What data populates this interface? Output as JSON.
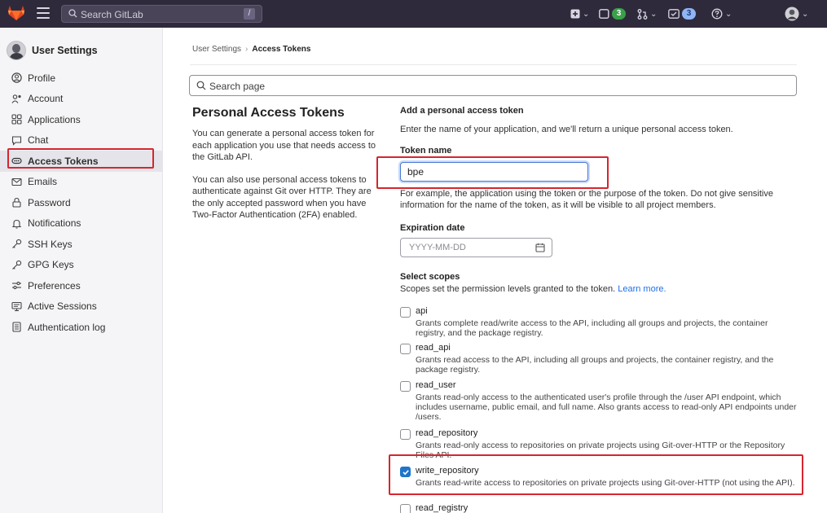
{
  "topbar": {
    "search_placeholder": "Search GitLab",
    "search_shortcut": "/",
    "mr_count": "3",
    "todo_count": "3",
    "colors": {
      "background": "#2f2a3b"
    }
  },
  "sidebar": {
    "context_title": "User Settings",
    "items": [
      {
        "label": "Profile",
        "icon": "profile-icon"
      },
      {
        "label": "Account",
        "icon": "account-icon"
      },
      {
        "label": "Applications",
        "icon": "applications-icon"
      },
      {
        "label": "Chat",
        "icon": "chat-icon"
      },
      {
        "label": "Access Tokens",
        "icon": "token-icon",
        "active": true
      },
      {
        "label": "Emails",
        "icon": "mail-icon"
      },
      {
        "label": "Password",
        "icon": "lock-icon"
      },
      {
        "label": "Notifications",
        "icon": "bell-icon"
      },
      {
        "label": "SSH Keys",
        "icon": "key-icon"
      },
      {
        "label": "GPG Keys",
        "icon": "key-icon"
      },
      {
        "label": "Preferences",
        "icon": "preferences-icon"
      },
      {
        "label": "Active Sessions",
        "icon": "monitor-icon"
      },
      {
        "label": "Authentication log",
        "icon": "log-icon"
      }
    ]
  },
  "breadcrumb": {
    "root": "User Settings",
    "separator": "›",
    "current": "Access Tokens"
  },
  "page_search": {
    "placeholder": "Search page"
  },
  "intro": {
    "title": "Personal Access Tokens",
    "paragraph_1": "You can generate a personal access token for each application you use that needs access to the GitLab API.",
    "paragraph_2": "You can also use personal access tokens to authenticate against Git over HTTP. They are the only accepted password when you have Two-Factor Authentication (2FA) enabled."
  },
  "form": {
    "heading": "Add a personal access token",
    "description": "Enter the name of your application, and we'll return a unique personal access token.",
    "token_name_label": "Token name",
    "token_name_value": "bpe",
    "token_name_help": "For example, the application using the token or the purpose of the token. Do not give sensitive information for the name of the token, as it will be visible to all project members.",
    "expiration_label": "Expiration date",
    "expiration_placeholder": "YYYY-MM-DD",
    "scopes_label": "Select scopes",
    "scopes_help": "Scopes set the permission levels granted to the token.",
    "scopes_link": "Learn more.",
    "scopes": [
      {
        "name": "api",
        "checked": false,
        "description": "Grants complete read/write access to the API, including all groups and projects, the container registry, and the package registry."
      },
      {
        "name": "read_api",
        "checked": false,
        "description": "Grants read access to the API, including all groups and projects, the container registry, and the package registry."
      },
      {
        "name": "read_user",
        "checked": false,
        "description": "Grants read-only access to the authenticated user's profile through the /user API endpoint, which includes username, public email, and full name. Also grants access to read-only API endpoints under /users."
      },
      {
        "name": "read_repository",
        "checked": false,
        "description": "Grants read-only access to repositories on private projects using Git-over-HTTP or the Repository Files API."
      },
      {
        "name": "write_repository",
        "checked": true,
        "description": "Grants read-write access to repositories on private projects using Git-over-HTTP (not using the API)."
      },
      {
        "name": "read_registry",
        "checked": false,
        "description": ""
      }
    ]
  },
  "colors": {
    "accent": "#1f75cb",
    "highlight_box": "#d6262e",
    "link": "#1f6feb"
  }
}
